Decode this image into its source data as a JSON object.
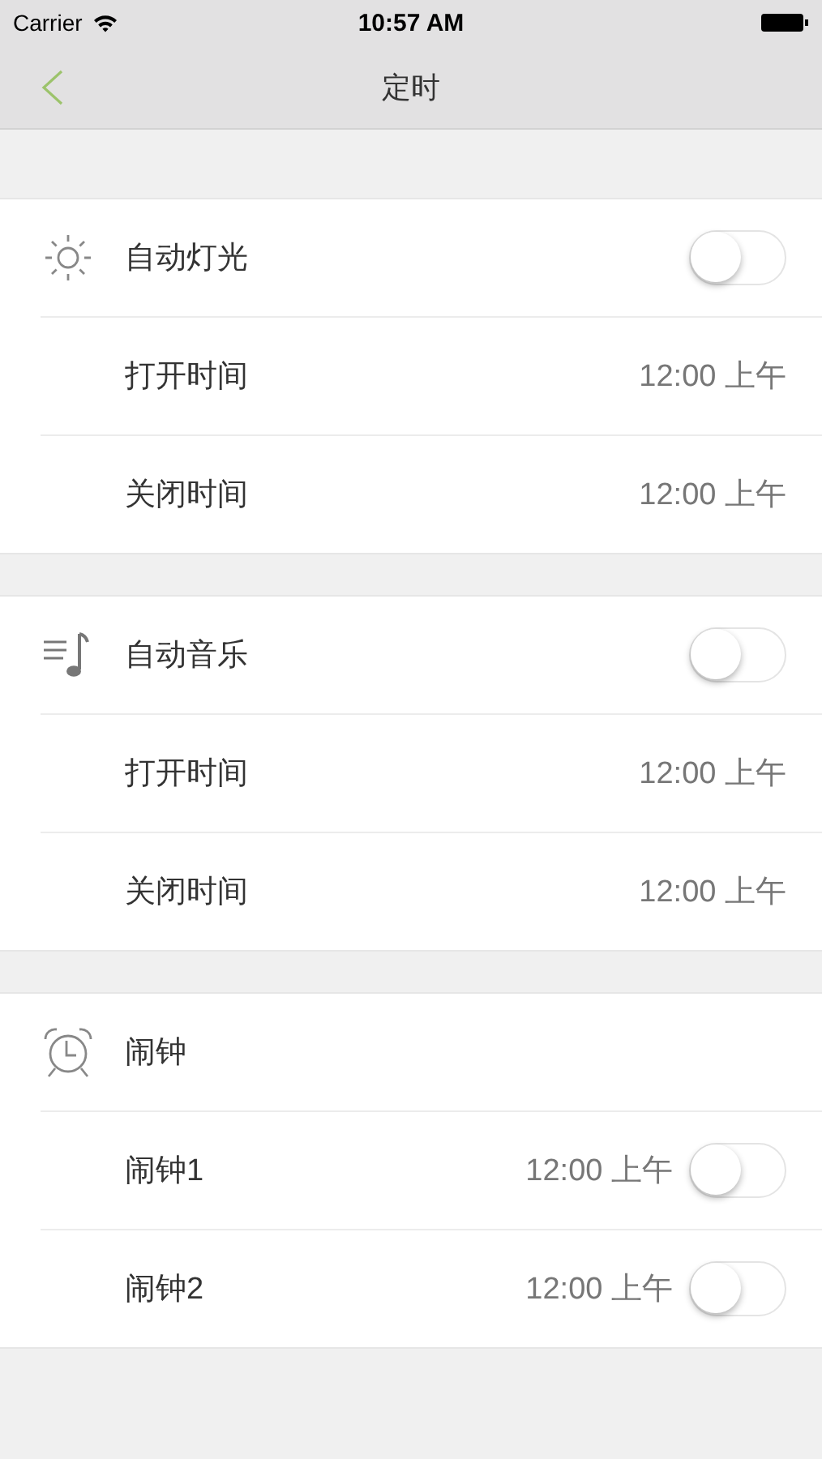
{
  "status_bar": {
    "carrier": "Carrier",
    "time": "10:57 AM"
  },
  "nav_bar": {
    "title": "定时"
  },
  "sections": [
    {
      "rows": [
        {
          "kind": "header",
          "label": "自动灯光",
          "on": false
        },
        {
          "kind": "item",
          "label": "打开时间",
          "value": "12:00 上午"
        },
        {
          "kind": "item",
          "label": "关闭时间",
          "value": "12:00 上午"
        }
      ]
    },
    {
      "rows": [
        {
          "kind": "header",
          "label": "自动音乐",
          "on": false
        },
        {
          "kind": "item",
          "label": "打开时间",
          "value": "12:00 上午"
        },
        {
          "kind": "item",
          "label": "关闭时间",
          "value": "12:00 上午"
        }
      ]
    },
    {
      "rows": [
        {
          "kind": "header",
          "label": "闹钟"
        },
        {
          "kind": "item",
          "label": "闹钟1",
          "value": "12:00 上午",
          "on": false
        },
        {
          "kind": "item",
          "label": "闹钟2",
          "value": "12:00 上午",
          "on": false
        }
      ]
    }
  ]
}
